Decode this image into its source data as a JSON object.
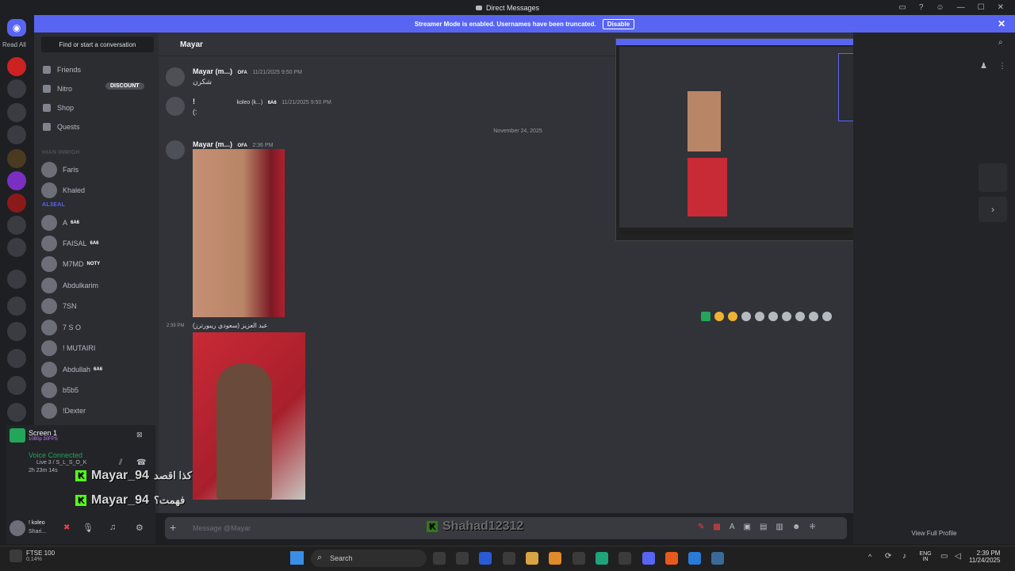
{
  "window": {
    "title": "Direct Messages"
  },
  "banner": {
    "text": "Streamer Mode is enabled. Usernames have been truncated.",
    "button": "Disable"
  },
  "servers": {
    "read_all": "Read All"
  },
  "sidebar": {
    "search_placeholder": "Find or start a conversation",
    "nav": [
      {
        "label": "Friends",
        "icon": "friends-icon"
      },
      {
        "label": "Nitro",
        "icon": "nitro-icon",
        "badge": "DISCOUNT"
      },
      {
        "label": "Shop",
        "icon": "shop-icon"
      },
      {
        "label": "Quests",
        "icon": "quests-icon"
      }
    ],
    "section_dm": "HIAN INMIGH",
    "section_group": "AL3EAL",
    "dms": [
      "Faris",
      "Khaled",
      "A",
      "FAISAL",
      "M7MD",
      "Abdulkarim",
      "7SN",
      "7 S O",
      "! MUTAIRI",
      "Abdullah",
      "b5b5",
      "!Dexter"
    ],
    "dm_tags": {
      "a": "6A6",
      "faisal": "6A6",
      "faisal_sub": "6A6",
      "m7md": "NOTY",
      "abdullah": "6A6"
    }
  },
  "panel": {
    "screen_title": "Screen 1",
    "screen_sub": "1080p 30FPS",
    "voice_status": "Voice Connected",
    "voice_channel": "Live 3 / S_L_S_O_K",
    "voice_time": "2h 23m 14s",
    "user_name": "! koleo",
    "user_status": "Shari..."
  },
  "channel": {
    "title": "Mayar"
  },
  "messages": [
    {
      "user": "Mayar (m...)",
      "tag": "OFA",
      "time": "11/21/2025 9:50 PM",
      "text": "شكرن"
    },
    {
      "user": "!",
      "extra": "koleo (k...)",
      "tag": "6A6",
      "time": "11/21/2025 9:50 PM",
      "text": "(:"
    },
    {
      "user": "Mayar (m...)",
      "tag": "OFA",
      "time": "2:36 PM"
    },
    {
      "time": "2:39 PM",
      "text": "عبد العزيز (سعودي ريبورترز)"
    }
  ],
  "divider": "November 24, 2025",
  "composer": {
    "placeholder": "Message @Mayar"
  },
  "overlays": {
    "line1_name": "Mayar_94",
    "line1_text": "كذا اقصد",
    "line2_name": "Mayar_94",
    "line2_text": "فهمت؟",
    "kick_user": "Shahad12312"
  },
  "right_panel": {
    "view_profile": "View Full Profile"
  },
  "taskbar": {
    "ticker": "FTSE 100",
    "ticker_change": "0,14%",
    "search": "Search",
    "lang1": "ENG",
    "lang2": "IN",
    "time": "2:39 PM",
    "date": "11/24/2025"
  },
  "colors": {
    "accent": "#5865f2",
    "green": "#23a55a",
    "kick": "#53fc18"
  }
}
